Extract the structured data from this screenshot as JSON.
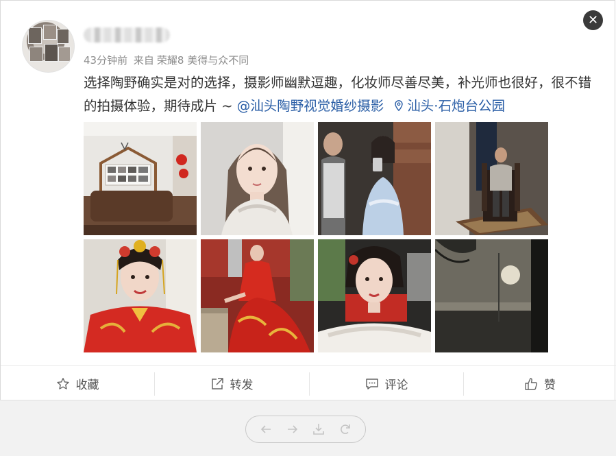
{
  "post": {
    "time": "43分钟前",
    "source_prefix": "来自",
    "source_device": "荣耀8 美得与众不同",
    "text_main": "选择陶野确实是对的选择，摄影师幽默逗趣，化妆师尽善尽美，补光师也很好，很不错的拍摄体验，期待成片 ~ ",
    "mention": "@汕头陶野视觉婚纱摄影",
    "location": "汕头·石炮台公园"
  },
  "photos": [
    {
      "icon": "photo-studio-lobby"
    },
    {
      "icon": "photo-bride-selfie-white"
    },
    {
      "icon": "photo-couple-mirror-selfie"
    },
    {
      "icon": "photo-groom-throne"
    },
    {
      "icon": "photo-bride-red-headdress"
    },
    {
      "icon": "photo-bride-red-qipao"
    },
    {
      "icon": "photo-bride-car-selfie"
    },
    {
      "icon": "photo-beach-sunset"
    }
  ],
  "actions": {
    "favorite": "收藏",
    "repost": "转发",
    "comment": "评论",
    "like": "赞"
  },
  "colors": {
    "link": "#2a5ea6",
    "meta": "#8c8c8c",
    "footer_bg": "#f2f2f2"
  }
}
